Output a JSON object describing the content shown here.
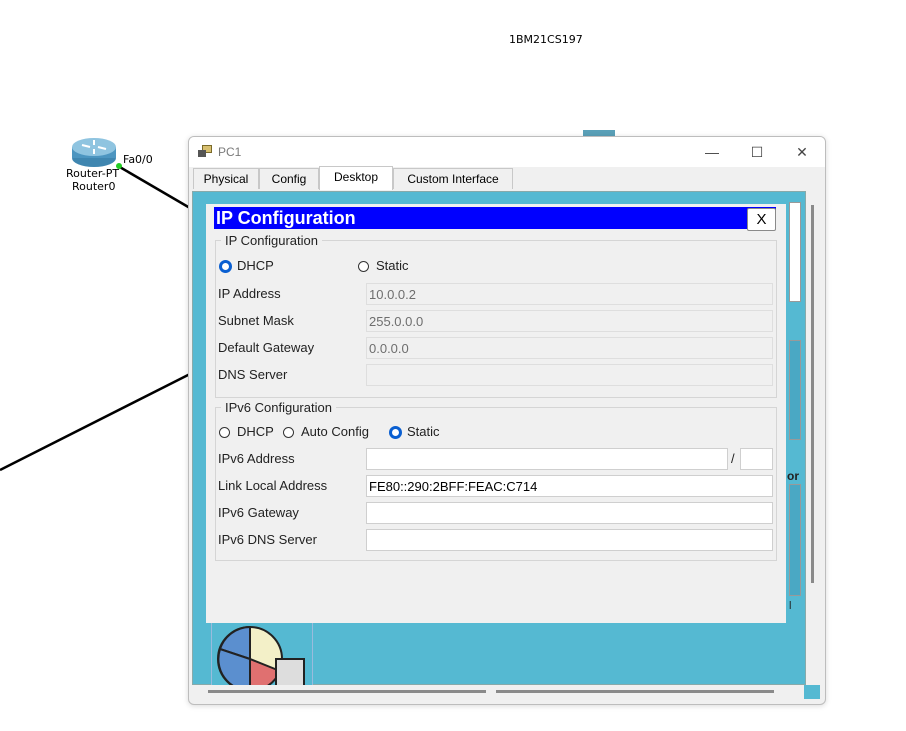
{
  "canvas": {
    "header_text": "1BM21CS197",
    "router": {
      "port_label": "Fa0/0",
      "type_label": "Router-PT",
      "name_label": "Router0"
    },
    "partial_text_1": "or",
    "partial_text_2": "l"
  },
  "window": {
    "title": "PC1",
    "controls": {
      "minimize": "—",
      "maximize": "☐",
      "close": "✕"
    },
    "tabs": [
      "Physical",
      "Config",
      "Desktop",
      "Custom Interface"
    ],
    "active_tab": "Desktop"
  },
  "ip_config": {
    "header": "IP Configuration",
    "close_label": "X",
    "ipv4": {
      "legend": "IP Configuration",
      "dhcp_label": "DHCP",
      "static_label": "Static",
      "mode": "DHCP",
      "rows": [
        {
          "label": "IP Address",
          "value": "10.0.0.2"
        },
        {
          "label": "Subnet Mask",
          "value": "255.0.0.0"
        },
        {
          "label": "Default Gateway",
          "value": "0.0.0.0"
        },
        {
          "label": "DNS Server",
          "value": ""
        }
      ]
    },
    "ipv6": {
      "legend": "IPv6 Configuration",
      "dhcp_label": "DHCP",
      "auto_label": "Auto Config",
      "static_label": "Static",
      "mode": "Static",
      "address_label": "IPv6 Address",
      "address_value": "",
      "prefix_separator": "/",
      "prefix_value": "",
      "link_local_label": "Link Local Address",
      "link_local_value": "FE80::290:2BFF:FEAC:C714",
      "gateway_label": "IPv6 Gateway",
      "gateway_value": "",
      "dns_label": "IPv6 DNS Server",
      "dns_value": ""
    }
  },
  "colors": {
    "dialog_header": "#0000ff",
    "desktop_bg": "#55b9d2",
    "radio_selected": "#0a5fd1",
    "link_led": "#22cc22"
  }
}
